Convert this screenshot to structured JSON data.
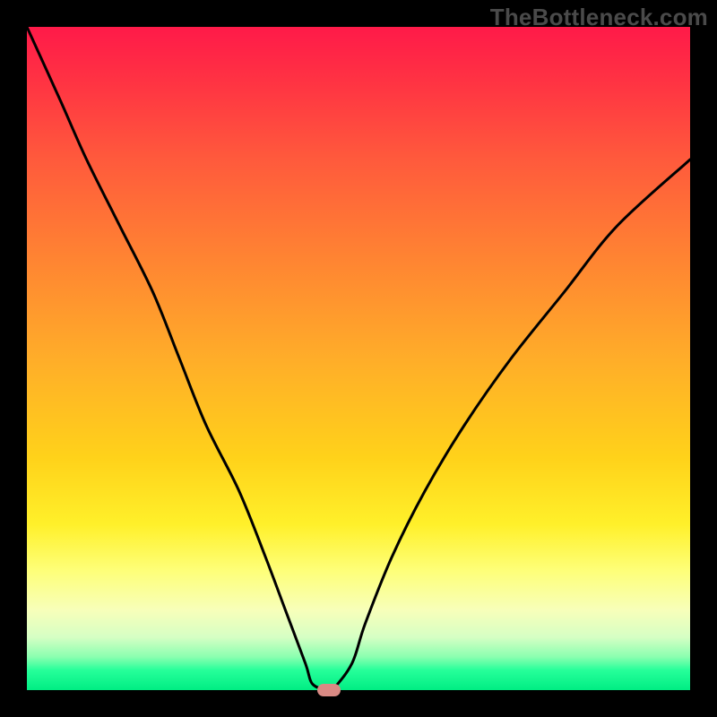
{
  "watermark": "TheBottleneck.com",
  "colors": {
    "frame": "#000000",
    "curve": "#000000",
    "marker": "#d98a84",
    "gradient_top": "#ff1a49",
    "gradient_bottom": "#00ed83"
  },
  "chart_data": {
    "type": "line",
    "title": "",
    "xlabel": "",
    "ylabel": "",
    "xlim": [
      0,
      100
    ],
    "ylim": [
      0,
      100
    ],
    "grid": false,
    "series": [
      {
        "name": "bottleneck-curve",
        "x": [
          0,
          5,
          9,
          14,
          19,
          23,
          27,
          32,
          36,
          39,
          42,
          43,
          45,
          46,
          49,
          51,
          55,
          60,
          66,
          73,
          81,
          89,
          100
        ],
        "values": [
          100,
          89,
          80,
          70,
          60,
          50,
          40,
          30,
          20,
          12,
          4,
          1,
          0,
          0,
          4,
          10,
          20,
          30,
          40,
          50,
          60,
          70,
          80
        ]
      }
    ],
    "annotations": [
      {
        "name": "optimal-marker",
        "x": 45.5,
        "y": 0,
        "shape": "rounded-rect",
        "color": "#d98a84"
      }
    ]
  }
}
